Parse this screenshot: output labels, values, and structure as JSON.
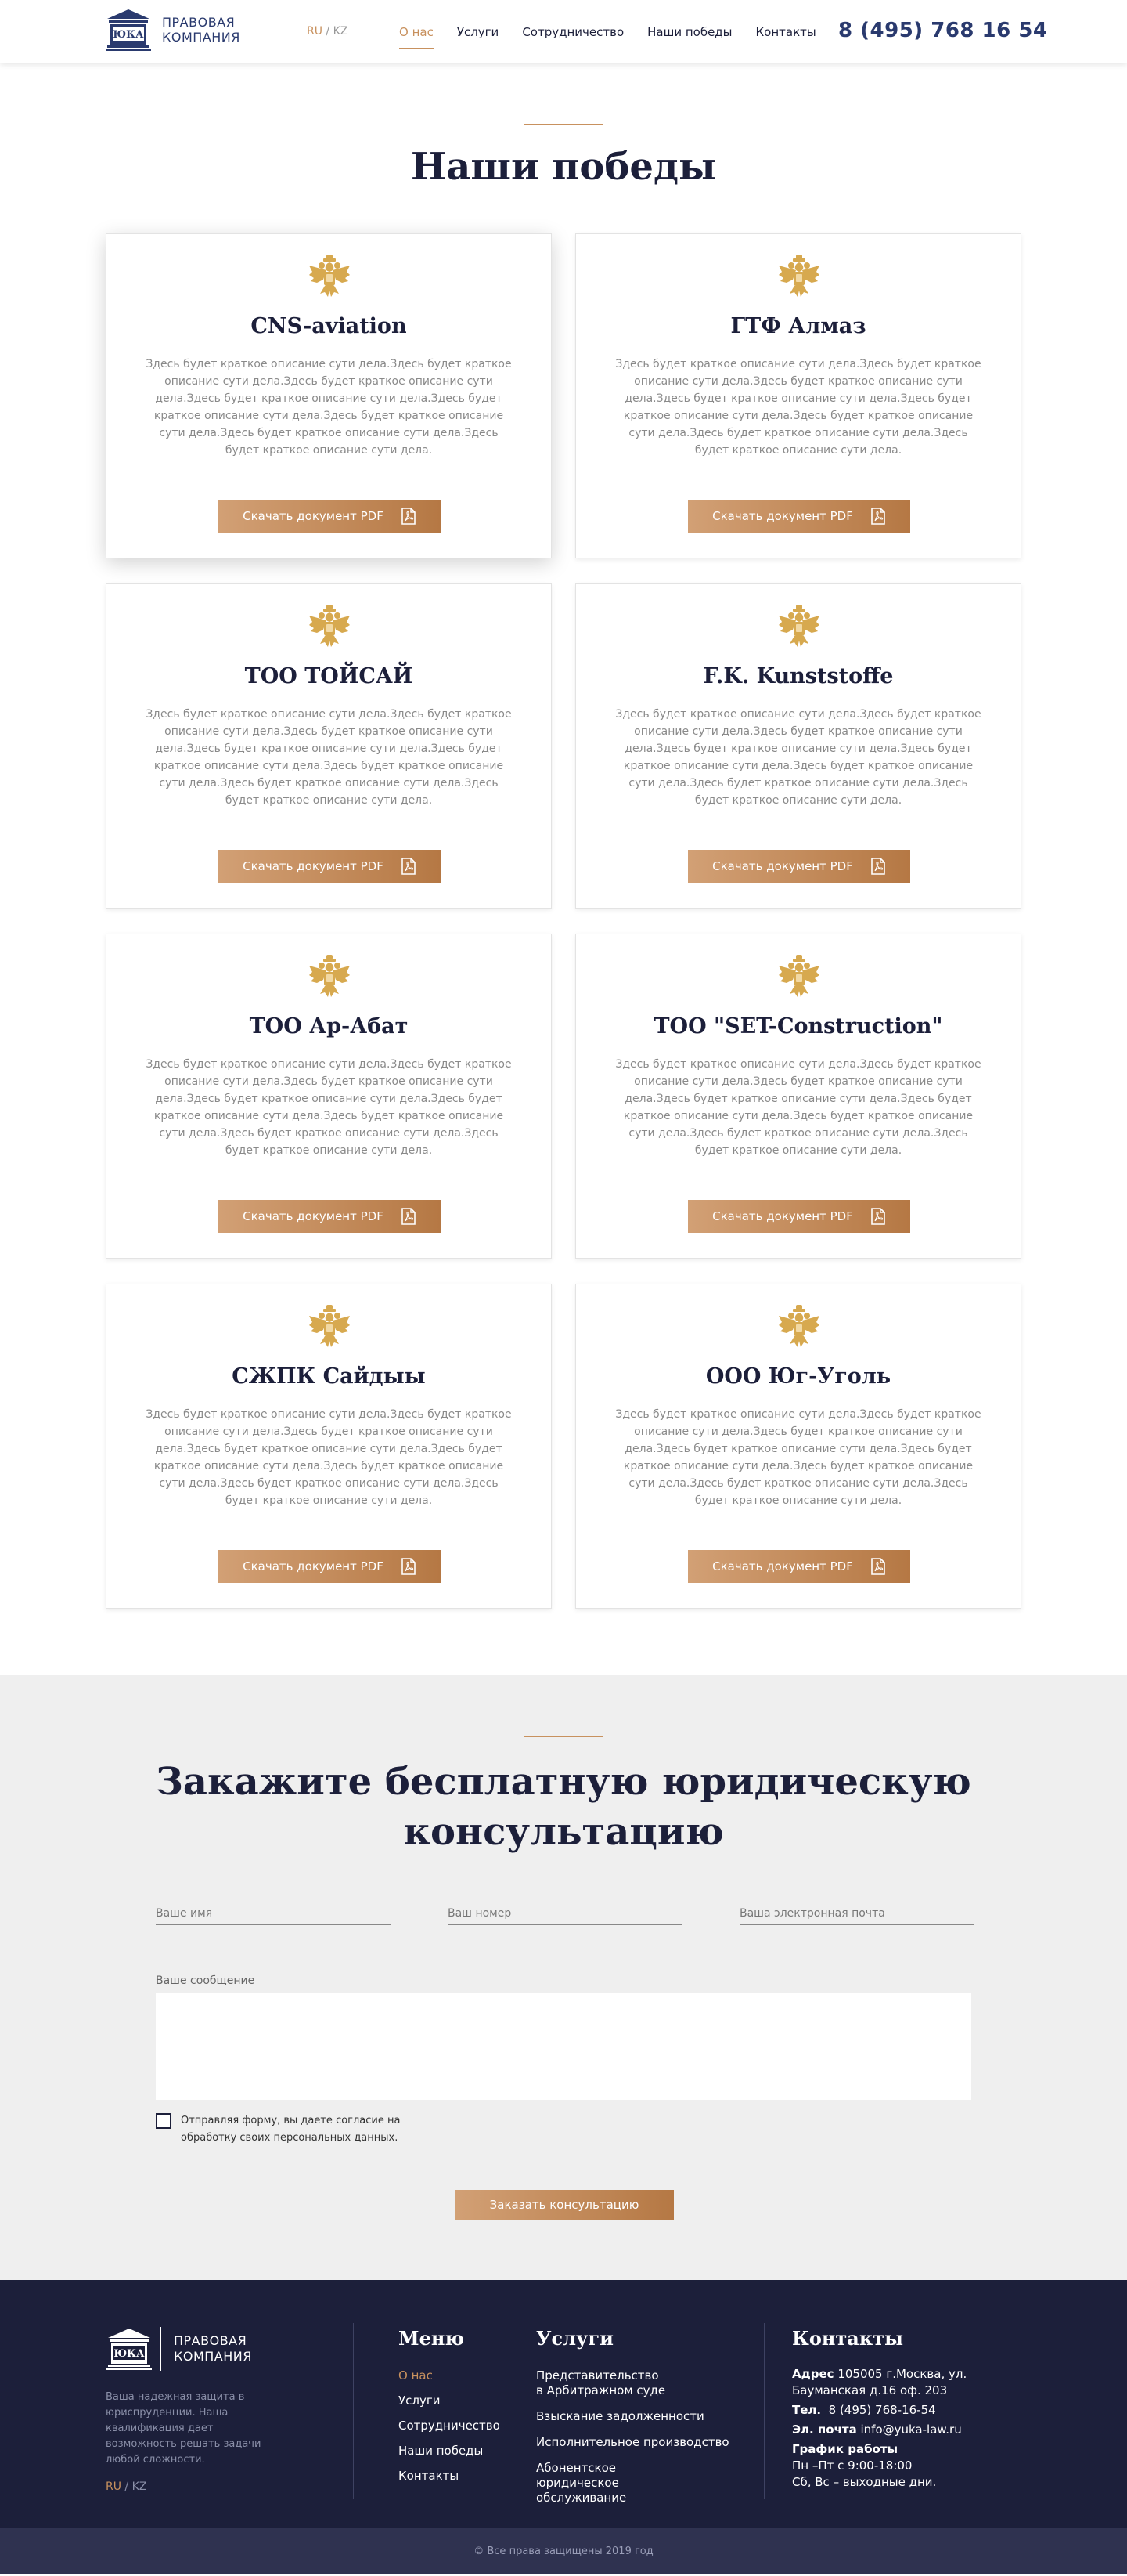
{
  "header": {
    "logo_line1": "ПРАВОВАЯ",
    "logo_line2": "КОМПАНИЯ",
    "lang_ru": "RU",
    "lang_sep": " / ",
    "lang_kz": "KZ",
    "nav": [
      "О нас",
      "Услуги",
      "Сотрудничество",
      "Наши победы",
      "Контакты"
    ],
    "phone": "8 (495) 768 16 54"
  },
  "wins": {
    "title": "Наши победы",
    "button_label": "Скачать документ PDF",
    "cards": [
      {
        "title": "CNS-aviation",
        "desc": "Здесь будет краткое описание сути дела.Здесь будет краткое описание сути дела.Здесь будет краткое описание сути дела.Здесь будет краткое описание сути дела.Здесь будет краткое описание сути дела.Здесь будет краткое описание сути дела.Здесь будет краткое описание сути дела.Здесь будет краткое описание сути дела."
      },
      {
        "title": "ГТФ Алмаз",
        "desc": "Здесь будет краткое описание сути дела.Здесь будет краткое описание сути дела.Здесь будет краткое описание сути дела.Здесь будет краткое описание сути дела.Здесь будет краткое описание сути дела.Здесь будет краткое описание сути дела.Здесь будет краткое описание сути дела.Здесь будет краткое описание сути дела."
      },
      {
        "title": "ТОО ТОЙСАЙ",
        "desc": "Здесь будет краткое описание сути дела.Здесь будет краткое описание сути дела.Здесь будет краткое описание сути дела.Здесь будет краткое описание сути дела.Здесь будет краткое описание сути дела.Здесь будет краткое описание сути дела.Здесь будет краткое описание сути дела.Здесь будет краткое описание сути дела."
      },
      {
        "title": "F.K. Kunststoffe",
        "desc": "Здесь будет краткое описание сути дела.Здесь будет краткое описание сути дела.Здесь будет краткое описание сути дела.Здесь будет краткое описание сути дела.Здесь будет краткое описание сути дела.Здесь будет краткое описание сути дела.Здесь будет краткое описание сути дела.Здесь будет краткое описание сути дела."
      },
      {
        "title": "ТОО Ар-Абат",
        "desc": "Здесь будет краткое описание сути дела.Здесь будет краткое описание сути дела.Здесь будет краткое описание сути дела.Здесь будет краткое описание сути дела.Здесь будет краткое описание сути дела.Здесь будет краткое описание сути дела.Здесь будет краткое описание сути дела.Здесь будет краткое описание сути дела."
      },
      {
        "title": "ТОО \"SET-Construction\"",
        "desc": "Здесь будет краткое описание сути дела.Здесь будет краткое описание сути дела.Здесь будет краткое описание сути дела.Здесь будет краткое описание сути дела.Здесь будет краткое описание сути дела.Здесь будет краткое описание сути дела.Здесь будет краткое описание сути дела.Здесь будет краткое описание сути дела."
      },
      {
        "title": "СЖПК Сайдыы",
        "desc": "Здесь будет краткое описание сути дела.Здесь будет краткое описание сути дела.Здесь будет краткое описание сути дела.Здесь будет краткое описание сути дела.Здесь будет краткое описание сути дела.Здесь будет краткое описание сути дела.Здесь будет краткое описание сути дела.Здесь будет краткое описание сути дела."
      },
      {
        "title": "ООО Юг-Уголь",
        "desc": "Здесь будет краткое описание сути дела.Здесь будет краткое описание сути дела.Здесь будет краткое описание сути дела.Здесь будет краткое описание сути дела.Здесь будет краткое описание сути дела.Здесь будет краткое описание сути дела.Здесь будет краткое описание сути дела.Здесь будет краткое описание сути дела."
      }
    ]
  },
  "consult": {
    "title_line1": "Закажите бесплатную юридическую",
    "title_line2": "консультацию",
    "name_placeholder": "Ваше имя",
    "phone_placeholder": "Ваш номер",
    "email_placeholder": "Ваша электронная почта",
    "message_label": "Ваше сообщение",
    "agree_text": "Отправляя форму, вы даете согласие на обработку своих персональных данных.",
    "submit_label": "Заказать консультацию"
  },
  "footer": {
    "logo_line1": "ПРАВОВАЯ",
    "logo_line2": "КОМПАНИЯ",
    "tagline": "Ваша надежная защита в юриспруденции. Наша квалификация дает возможность решать задачи любой сложности.",
    "lang_ru": "RU",
    "lang_sep": " / ",
    "lang_kz": "KZ",
    "menu_title": "Меню",
    "menu": [
      "О нас",
      "Услуги",
      "Сотрудничество",
      "Наши победы",
      "Контакты"
    ],
    "services_title": "Услуги",
    "services": [
      "Представительство в Арбитражном суде",
      "Взыскание задолженности",
      "Исполнительное производство",
      "Абонентское юридическое обслуживание"
    ],
    "contacts_title": "Контакты",
    "address_label": "Адрес",
    "address_value": "105005 г.Москва, ул. Бауманская д.16 оф. 203",
    "phone_label": "Тел.",
    "phone_value": "8 (495) 768-16-54",
    "email_label": "Эл. почта",
    "email_value": "info@yuka-law.ru",
    "schedule_label": "График работы",
    "schedule_weekdays": "Пн –Пт с 9:00-18:00",
    "schedule_weekend": "Сб, Вс – выходные дни."
  },
  "copyright": "© Все права защищены 2019 год",
  "colors": {
    "accent": "#c8915e",
    "navy": "#1c1f3a",
    "brand_blue": "#2a3a6e",
    "gray_bg": "#efefef"
  },
  "icons": [
    "logo-building-icon",
    "eagle-emblem-icon",
    "pdf-icon"
  ]
}
